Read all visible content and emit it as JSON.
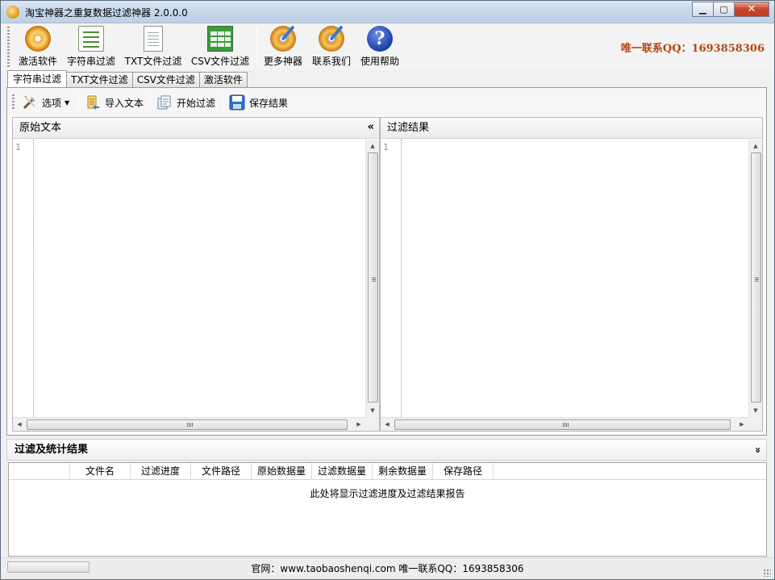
{
  "window": {
    "title": "淘宝神器之重复数据过滤神器 2.0.0.0",
    "min_label": "▁",
    "max_label": "▢",
    "close_label": "✕"
  },
  "toolbar": {
    "buttons": [
      {
        "label": "激活软件",
        "icon": "activate-disc-icon"
      },
      {
        "label": "字符串过滤",
        "icon": "list-icon"
      },
      {
        "label": "TXT文件过滤",
        "icon": "text-file-icon"
      },
      {
        "label": "CSV文件过滤",
        "icon": "spreadsheet-icon"
      },
      {
        "label": "更多神器",
        "icon": "more-disc-icon"
      },
      {
        "label": "联系我们",
        "icon": "contact-disc-icon"
      },
      {
        "label": "使用帮助",
        "icon": "help-icon"
      }
    ],
    "qq": "唯一联系QQ：1693858306"
  },
  "tabs": [
    "字符串过滤",
    "TXT文件过滤",
    "CSV文件过滤",
    "激活软件"
  ],
  "subtoolbar": {
    "options": "选项",
    "import": "导入文本",
    "start": "开始过滤",
    "save": "保存结果"
  },
  "left_panel": {
    "title": "原始文本",
    "line_number": "1",
    "collapse": "«"
  },
  "right_panel": {
    "title": "过滤结果",
    "line_number": "1"
  },
  "results": {
    "title": "过滤及统计结果",
    "chevron": "»",
    "columns": [
      "",
      "文件名",
      "过滤进度",
      "文件路径",
      "原始数据量",
      "过滤数据量",
      "剩余数据量",
      "保存路径"
    ],
    "empty": "此处将显示过滤进度及过滤结果报告"
  },
  "status": {
    "text": "官网：www.taobaoshenqi.com 唯一联系QQ：1693858306"
  },
  "colors": {
    "qq_text": "#b3460f",
    "title_bar": "#c5d6ea",
    "close_button": "#c7452c"
  }
}
